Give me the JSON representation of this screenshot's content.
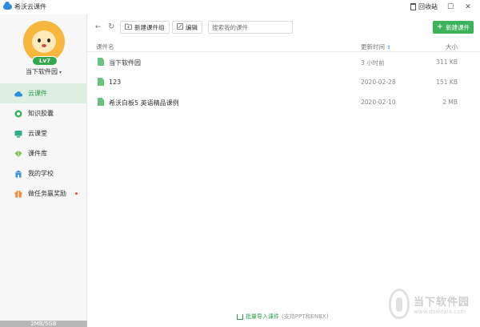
{
  "window": {
    "title": "希沃云课件",
    "recycle_label": "回收站",
    "minimize_glyph": "—",
    "maximize_glyph": "☐",
    "close_glyph": "✕"
  },
  "user": {
    "level": "Lv7",
    "name": "当下软件园",
    "caret": "▾"
  },
  "sidebar": {
    "items": [
      {
        "label": "云课件",
        "icon": "cloud-icon",
        "active": true
      },
      {
        "label": "知识胶囊",
        "icon": "capsule-icon"
      },
      {
        "label": "云课堂",
        "icon": "classroom-icon"
      },
      {
        "label": "课件库",
        "icon": "library-icon"
      },
      {
        "label": "我的学校",
        "icon": "school-icon"
      },
      {
        "label": "做任务赢奖励",
        "icon": "gift-icon",
        "badge": "red-dot"
      }
    ],
    "storage": "2MB/5GB"
  },
  "toolbar": {
    "new_group_label": "新建课件组",
    "edit_label": "编辑",
    "search_placeholder": "搜索我的课件",
    "new_course_label": "新建课件"
  },
  "table": {
    "headers": {
      "name": "课件名",
      "date": "更新时间",
      "size": "大小"
    },
    "rows": [
      {
        "name": "当下软件园",
        "date": "3 小时前",
        "size": "311 KB"
      },
      {
        "name": "123",
        "date": "2020-02-28",
        "size": "151 KB"
      },
      {
        "name": "希沃白板5 英语精品课例",
        "date": "2020-02-10",
        "size": "2 MB"
      }
    ]
  },
  "footer": {
    "import_label": "批量导入课件",
    "import_hint": "(支持PPT和ENBX)"
  },
  "watermark": {
    "cn": "当下软件园",
    "en": "www.downxia.com"
  },
  "colors": {
    "accent_green": "#3cb35a",
    "active_bg": "#dcefe0",
    "file_icon": "#69c27f"
  }
}
